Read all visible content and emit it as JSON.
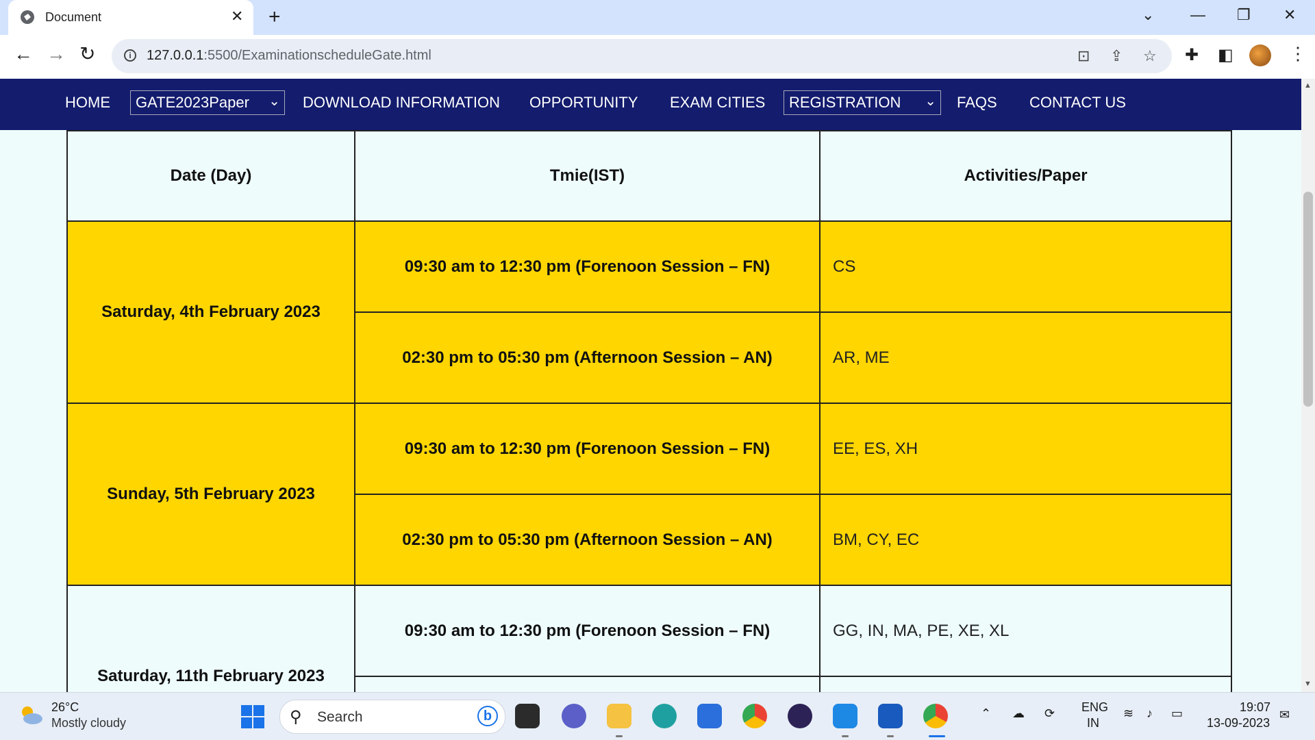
{
  "browser": {
    "tab_title": "Document",
    "new_tab_symbol": "+",
    "close_symbol": "✕",
    "url_host": "127.0.0.1",
    "url_rest": ":5500/ExaminationscheduleGate.html"
  },
  "nav": {
    "home": "HOME",
    "paper_select": "GATE2023Paper",
    "download": "DOWNLOAD INFORMATION",
    "opportunity": "OPPORTUNITY",
    "exam_cities": "EXAM CITIES",
    "registration_select": "REGISTRATION",
    "faqs": "FAQS",
    "contact": "CONTACT US"
  },
  "table": {
    "headers": [
      "Date (Day)",
      "Tmie(IST)",
      "Activities/Paper"
    ],
    "days": [
      {
        "date": "Saturday, 4th February 2023",
        "highlight": "#ffd600",
        "sessions": [
          {
            "time": "09:30 am to 12:30 pm (Forenoon Session – FN)",
            "papers": "CS"
          },
          {
            "time": "02:30 pm to 05:30 pm (Afternoon Session – AN)",
            "papers": "AR, ME"
          }
        ]
      },
      {
        "date": "Sunday, 5th February 2023",
        "highlight": "#ffd600",
        "sessions": [
          {
            "time": "09:30 am to 12:30 pm (Forenoon Session – FN)",
            "papers": "EE, ES, XH"
          },
          {
            "time": "02:30 pm to 05:30 pm (Afternoon Session – AN)",
            "papers": "BM, CY, EC"
          }
        ]
      },
      {
        "date": "Saturday, 11th February 2023",
        "highlight": "#eefcfc",
        "sessions": [
          {
            "time": "09:30 am to 12:30 pm (Forenoon Session – FN)",
            "papers": "GG, IN, MA, PE, XE, XL"
          }
        ]
      }
    ]
  },
  "taskbar": {
    "temperature": "26°C",
    "weather": "Mostly cloudy",
    "search_label": "Search",
    "lang_top": "ENG",
    "lang_bottom": "IN",
    "time": "19:07",
    "date": "13-09-2023"
  },
  "colors": {
    "nav_bg": "#131c6d",
    "page_bg": "#eefcfc",
    "highlight": "#ffd600"
  }
}
